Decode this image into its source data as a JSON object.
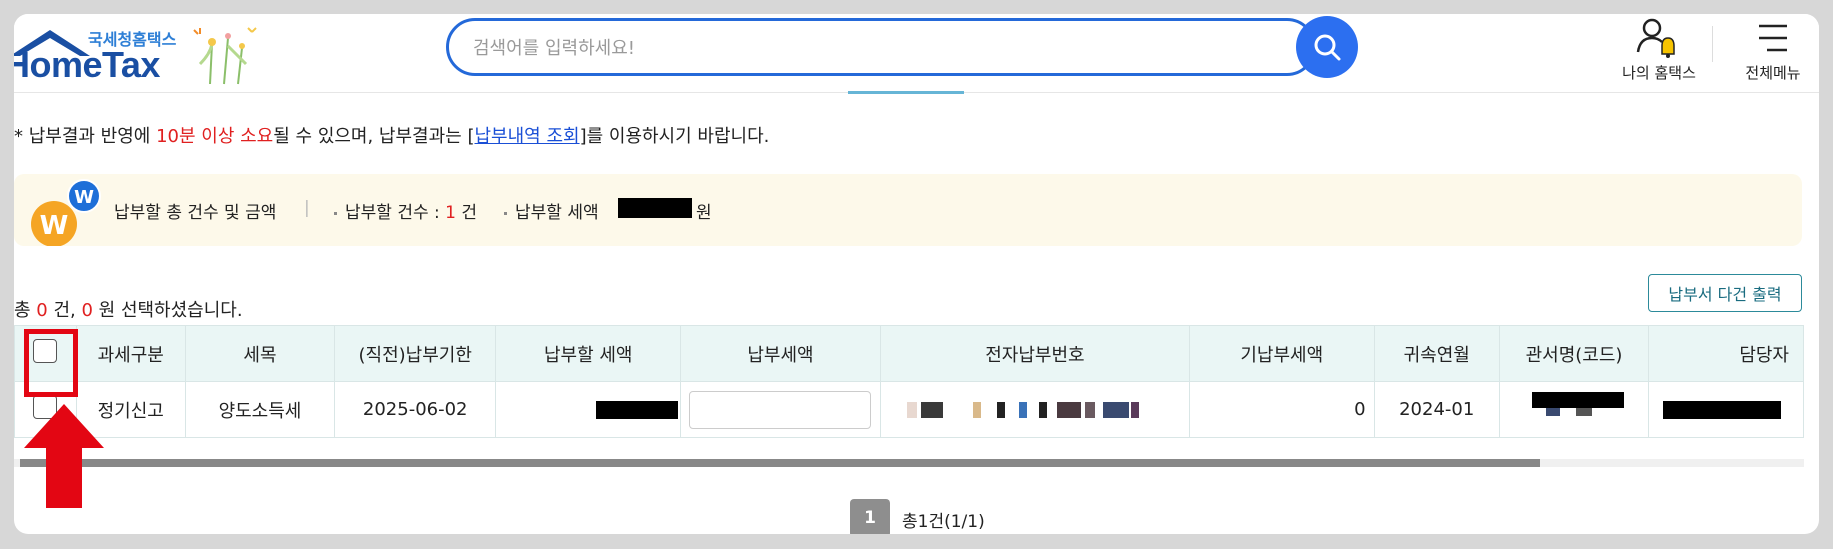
{
  "header": {
    "logo_sub": "국세청홈택스",
    "logo_main": "HomeTax",
    "search_placeholder": "검색어를 입력하세요!",
    "my_hometax_label": "나의 홈택스",
    "all_menu_label": "전체메뉴"
  },
  "notice": {
    "prefix": "* 납부결과 반영에 ",
    "highlight": "10분 이상 소요",
    "middle": "될 수 있으며, 납부결과는 [",
    "link": "납부내역 조회",
    "suffix": "]를 이용하시기 바랍니다."
  },
  "summary": {
    "title": "납부할 총 건수 및 금액",
    "separator": "|",
    "count_label": "납부할 건수 : ",
    "count_value": "1",
    "count_unit": " 건",
    "amount_label": "납부할 세액",
    "amount_unit": "원"
  },
  "selection": {
    "prefix": "총 ",
    "count": "0",
    "count_unit": " 건, ",
    "amount": "0",
    "suffix": " 원 선택하셨습니다."
  },
  "print_button": "납부서 다건 출력",
  "table": {
    "headers": [
      "과세구분",
      "세목",
      "(직전)납부기한",
      "납부할 세액",
      "납부세액",
      "전자납부번호",
      "기납부세액",
      "귀속연월",
      "관서명(코드)",
      "담당자"
    ],
    "rows": [
      {
        "tax_type": "정기신고",
        "tax_item": "양도소득세",
        "due_date": "2025-06-02",
        "prepaid": "0",
        "period": "2024-01"
      }
    ]
  },
  "pagination": {
    "current": "1",
    "total": "총1건(1/1)"
  },
  "colors": {
    "accent": "#2469d9",
    "highlight_red": "#e30613",
    "table_header_bg": "#eaf6f5",
    "summary_bg": "#fdf9ea"
  }
}
